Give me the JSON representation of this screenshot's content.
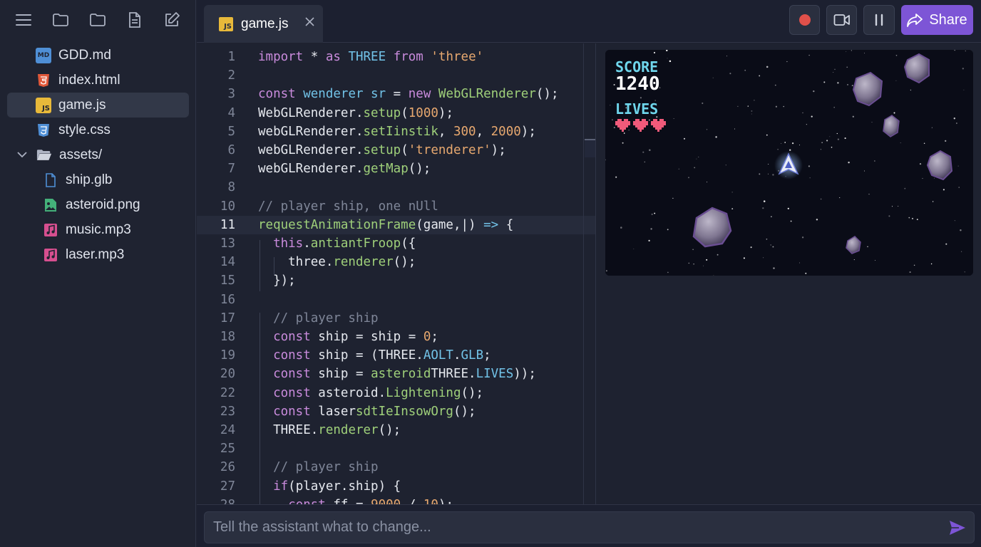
{
  "sidebar": {
    "toolbar": [
      "menu-icon",
      "folder-icon",
      "folder-icon",
      "file-icon",
      "edit-icon"
    ],
    "files": [
      {
        "name": "GDD.md",
        "icon": "markdown-icon",
        "badge": "MD",
        "color": "#4f8fd6"
      },
      {
        "name": "index.html",
        "icon": "html-icon",
        "badge": "5",
        "color": "#e0583a"
      },
      {
        "name": "game.js",
        "icon": "js-icon",
        "badge": "JS",
        "color": "#e8b93a",
        "active": true
      },
      {
        "name": "style.css",
        "icon": "css-icon",
        "badge": "3",
        "color": "#4f8fd6"
      },
      {
        "name": "assets/",
        "icon": "folder-open-icon",
        "expanded": true
      },
      {
        "name": "ship.glb",
        "icon": "file-icon",
        "color": "#4f8fd6"
      },
      {
        "name": "asteroid.png",
        "icon": "image-icon",
        "color": "#44b07a"
      },
      {
        "name": "music.mp3",
        "icon": "music-icon",
        "color": "#d64f8f"
      },
      {
        "name": "laser.mp3",
        "icon": "music-icon",
        "color": "#d64f8f"
      }
    ]
  },
  "tab": {
    "name": "game.js",
    "badge": "JS"
  },
  "controls": {
    "share_label": "Share"
  },
  "editor": {
    "lines": [
      {
        "n": "1",
        "html": "<span class='kw'>import</span> * <span class='kw'>as</span> <span class='tp'>THREE</span> <span class='kw'>from</span> <span class='st'>'three'</span>"
      },
      {
        "n": "2",
        "html": ""
      },
      {
        "n": "3",
        "html": "<span class='kw'>const</span> <span class='tp'>wenderer sr</span> = <span class='kw'>new</span> <span class='fn'>WebGLRenderer</span>();"
      },
      {
        "n": "4",
        "html": "WebGLRenderer.<span class='fn'>setup</span>(<span class='nm'>1000</span>);"
      },
      {
        "n": "5",
        "html": "webGLRenderer.<span class='fn'>setIinstik</span>, <span class='nm'>300</span>, <span class='nm'>2000</span>);"
      },
      {
        "n": "6",
        "html": "webGLRenderer.<span class='fn'>setup</span>(<span class='st'>'trenderer'</span>);"
      },
      {
        "n": "7",
        "html": "webGLRenderer.<span class='fn'>getMap</span>();"
      },
      {
        "n": "8",
        "html": ""
      },
      {
        "n": "10",
        "html": "<span class='cm'>// player ship, one nUll</span>"
      },
      {
        "n": "11",
        "html": "<span class='fn'>requestAnimationFrame</span>(game,|) <span class='tp'>=&gt;</span> {",
        "current": true
      },
      {
        "n": "13",
        "html": "  <span class='kw'>this</span>.<span class='fn'>antiantFroop</span>({"
      },
      {
        "n": "14",
        "html": "    three.<span class='fn'>renderer</span>();"
      },
      {
        "n": "15",
        "html": "  });"
      },
      {
        "n": "16",
        "html": ""
      },
      {
        "n": "17",
        "html": "  <span class='cm'>// player ship</span>"
      },
      {
        "n": "18",
        "html": "  <span class='kw'>const</span> ship = ship = <span class='nm'>0</span>;"
      },
      {
        "n": "19",
        "html": "  <span class='kw'>const</span> ship = (THREE.<span class='tp'>AOLT</span>.<span class='tp'>GLB</span>;"
      },
      {
        "n": "20",
        "html": "  <span class='kw'>const</span> ship = <span class='fn'>asteroid</span>THREE.<span class='tp'>LIVES</span>));"
      },
      {
        "n": "22",
        "html": "  <span class='kw'>const</span> asteroid.<span class='fn'>Lightening</span>();"
      },
      {
        "n": "23",
        "html": "  <span class='kw'>const</span> laser<span class='fn'>sdtIeInsowOrg</span>();"
      },
      {
        "n": "24",
        "html": "  THREE.<span class='fn'>renderer</span>();"
      },
      {
        "n": "25",
        "html": ""
      },
      {
        "n": "26",
        "html": "  <span class='cm'>// player ship</span>"
      },
      {
        "n": "27",
        "html": "  <span class='kw'>if</span>(player.ship) {"
      },
      {
        "n": "28",
        "html": "    <span class='kw'>const</span> ff = <span class='nm'>9000</span> / <span class='nm'>10</span>);"
      }
    ]
  },
  "game": {
    "score_label": "SCORE",
    "score": "1240",
    "lives_label": "LIVES",
    "lives": 3
  },
  "prompt": {
    "placeholder": "Tell the assistant what to change..."
  },
  "colors": {
    "accent": "#7d55d6",
    "record": "#e0504a"
  }
}
